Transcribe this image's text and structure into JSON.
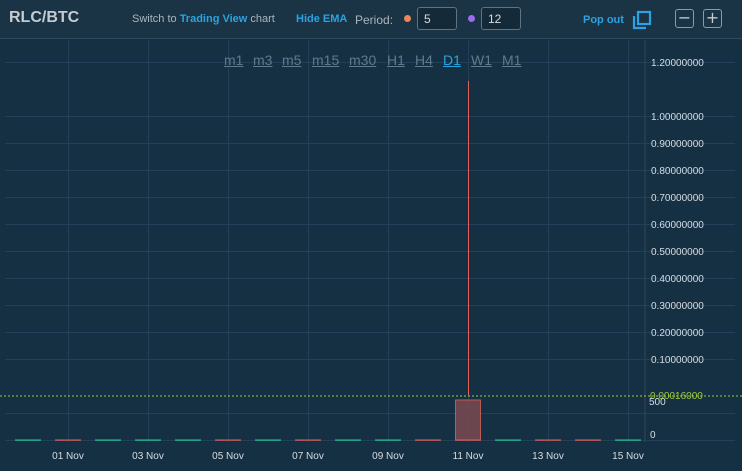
{
  "header": {
    "title": "RLC/BTC",
    "switch_prefix": "Switch to ",
    "switch_link": "Trading View",
    "switch_suffix": " chart",
    "hide_ema": "Hide EMA",
    "period_label": "Period:",
    "period_fast": "5",
    "period_slow": "12",
    "popout": "Pop out",
    "zoom_out": "−",
    "zoom_in": "+"
  },
  "timeframes": [
    {
      "label": "m1",
      "active": false
    },
    {
      "label": "m3",
      "active": false
    },
    {
      "label": "m5",
      "active": false
    },
    {
      "label": "m15",
      "active": false
    },
    {
      "label": "m30",
      "active": false
    },
    {
      "label": "H1",
      "active": false
    },
    {
      "label": "H4",
      "active": false
    },
    {
      "label": "D1",
      "active": true
    },
    {
      "label": "W1",
      "active": false
    },
    {
      "label": "M1",
      "active": false
    }
  ],
  "colors": {
    "background": "#163043",
    "grid": "#23405a",
    "up": "#26c69a",
    "down": "#e0605a",
    "price_line": "#9ccc3c",
    "accent": "#2aa3e0",
    "ema_fast": "#f0855a",
    "ema_slow": "#9b6cf0"
  },
  "chart_data": {
    "type": "candlestick",
    "y_ticks": [
      "1.20000000",
      "1.00000000",
      "0.90000000",
      "0.80000000",
      "0.70000000",
      "0.60000000",
      "0.50000000",
      "0.40000000",
      "0.30000000",
      "0.20000000",
      "0.10000000"
    ],
    "ylim": [
      0,
      1.2
    ],
    "current_price": "0.00016000",
    "volume_ticks": [
      "500",
      "0"
    ],
    "x_tick_labels": [
      "01 Nov",
      "03 Nov",
      "05 Nov",
      "07 Nov",
      "09 Nov",
      "11 Nov",
      "13 Nov",
      "15 Nov"
    ],
    "candles": [
      {
        "date": "31 Oct",
        "dir": "up",
        "high": 0.00016,
        "volume": 0
      },
      {
        "date": "01 Nov",
        "dir": "down",
        "high": 0.00016,
        "volume": 0
      },
      {
        "date": "02 Nov",
        "dir": "up",
        "high": 0.00016,
        "volume": 0
      },
      {
        "date": "03 Nov",
        "dir": "up",
        "high": 0.00016,
        "volume": 0
      },
      {
        "date": "04 Nov",
        "dir": "up",
        "high": 0.00016,
        "volume": 0
      },
      {
        "date": "05 Nov",
        "dir": "down",
        "high": 0.00016,
        "volume": 0
      },
      {
        "date": "06 Nov",
        "dir": "up",
        "high": 0.00016,
        "volume": 0
      },
      {
        "date": "07 Nov",
        "dir": "down",
        "high": 0.00016,
        "volume": 0
      },
      {
        "date": "08 Nov",
        "dir": "up",
        "high": 0.00016,
        "volume": 0
      },
      {
        "date": "09 Nov",
        "dir": "up",
        "high": 0.00016,
        "volume": 0
      },
      {
        "date": "10 Nov",
        "dir": "down",
        "high": 0.00016,
        "volume": 0
      },
      {
        "date": "11 Nov",
        "dir": "down",
        "high": 1.13,
        "volume": 560
      },
      {
        "date": "12 Nov",
        "dir": "up",
        "high": 0.00016,
        "volume": 0
      },
      {
        "date": "13 Nov",
        "dir": "down",
        "high": 0.00016,
        "volume": 0
      },
      {
        "date": "14 Nov",
        "dir": "down",
        "high": 0.00016,
        "volume": 0
      },
      {
        "date": "15 Nov",
        "dir": "up",
        "high": 0.00016,
        "volume": 0
      }
    ]
  }
}
